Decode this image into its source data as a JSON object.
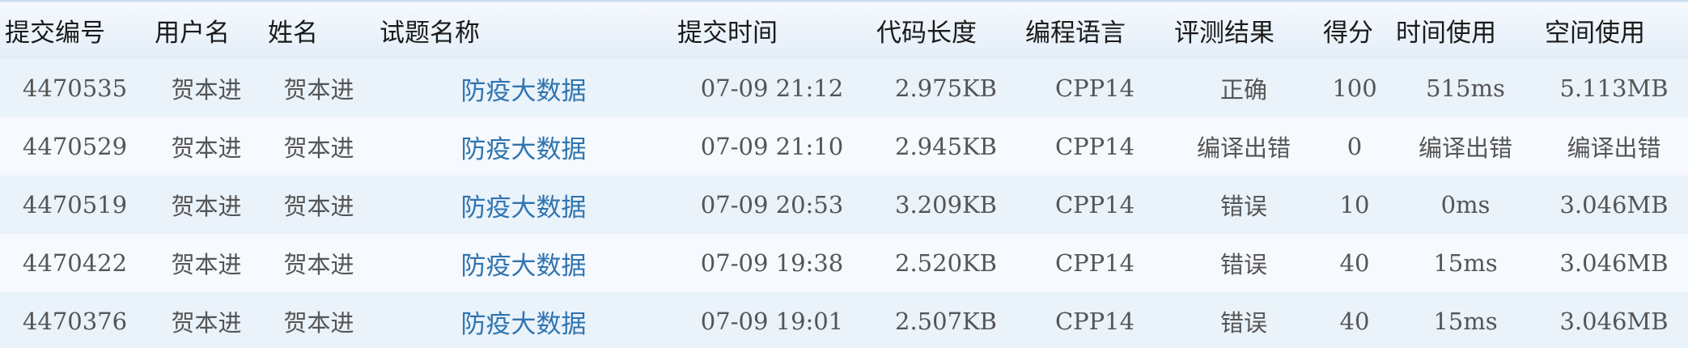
{
  "columns": [
    "提交编号",
    "用户名",
    "姓名",
    "试题名称",
    "提交时间",
    "代码长度",
    "编程语言",
    "评测结果",
    "得分",
    "时间使用",
    "空间使用"
  ],
  "rows": [
    {
      "id": "4470535",
      "username": "贺本进",
      "name": "贺本进",
      "problem": "防疫大数据",
      "time": "07-09 21:12",
      "length": "2.975KB",
      "lang": "CPP14",
      "result": "正确",
      "score": "100",
      "time_used": "515ms",
      "mem_used": "5.113MB"
    },
    {
      "id": "4470529",
      "username": "贺本进",
      "name": "贺本进",
      "problem": "防疫大数据",
      "time": "07-09 21:10",
      "length": "2.945KB",
      "lang": "CPP14",
      "result": "编译出错",
      "score": "0",
      "time_used": "编译出错",
      "mem_used": "编译出错"
    },
    {
      "id": "4470519",
      "username": "贺本进",
      "name": "贺本进",
      "problem": "防疫大数据",
      "time": "07-09 20:53",
      "length": "3.209KB",
      "lang": "CPP14",
      "result": "错误",
      "score": "10",
      "time_used": "0ms",
      "mem_used": "3.046MB"
    },
    {
      "id": "4470422",
      "username": "贺本进",
      "name": "贺本进",
      "problem": "防疫大数据",
      "time": "07-09 19:38",
      "length": "2.520KB",
      "lang": "CPP14",
      "result": "错误",
      "score": "40",
      "time_used": "15ms",
      "mem_used": "3.046MB"
    },
    {
      "id": "4470376",
      "username": "贺本进",
      "name": "贺本进",
      "problem": "防疫大数据",
      "time": "07-09 19:01",
      "length": "2.507KB",
      "lang": "CPP14",
      "result": "错误",
      "score": "40",
      "time_used": "15ms",
      "mem_used": "3.046MB"
    }
  ]
}
